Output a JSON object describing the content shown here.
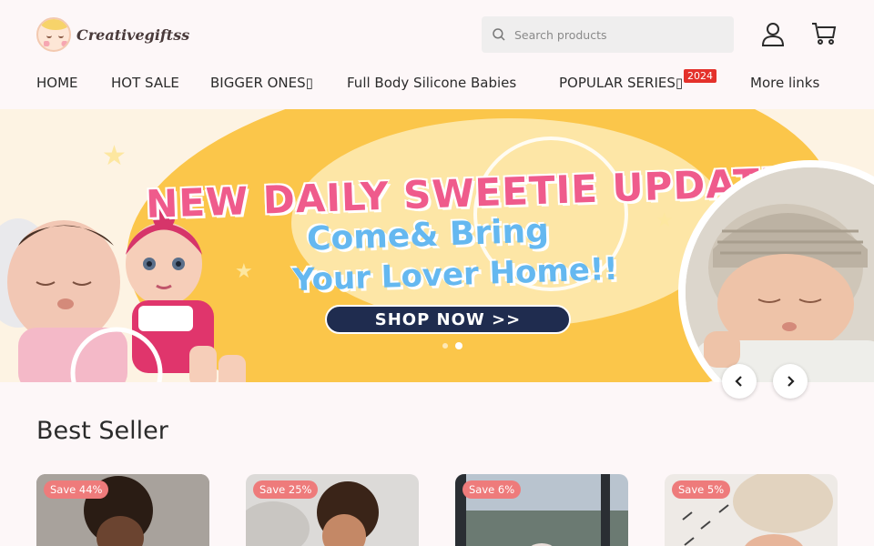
{
  "brand": {
    "name": "Creativegiftss"
  },
  "search": {
    "placeholder": "Search products"
  },
  "nav": [
    {
      "label": "HOME"
    },
    {
      "label": "HOT SALE"
    },
    {
      "label": "BIGGER ONES▯"
    },
    {
      "label": "Full Body Silicone Babies"
    },
    {
      "label": "POPULAR SERIES▯"
    },
    {
      "label": "More links"
    }
  ],
  "nav_badge": "2024",
  "banner": {
    "title": "NEW DAILY SWEETIE UPDATE",
    "line1": "Come& Bring",
    "line2": "Your Lover Home!!",
    "cta": "SHOP NOW >>",
    "slide_count": 2,
    "active_slide": 2
  },
  "best_seller": {
    "title": "Best Seller",
    "products": [
      {
        "save": "Save 44%"
      },
      {
        "save": "Save 25%"
      },
      {
        "save": "Save 6%"
      },
      {
        "save": "Save 5%"
      }
    ]
  },
  "colors": {
    "accent_badge": "#e4312b",
    "save_badge": "#ee7b7b",
    "cta_bg": "#1f2c4f",
    "banner_yellow": "#fbc64a"
  },
  "icons": [
    "search-icon",
    "account-icon",
    "cart-icon",
    "chevron-left-icon",
    "chevron-right-icon"
  ]
}
